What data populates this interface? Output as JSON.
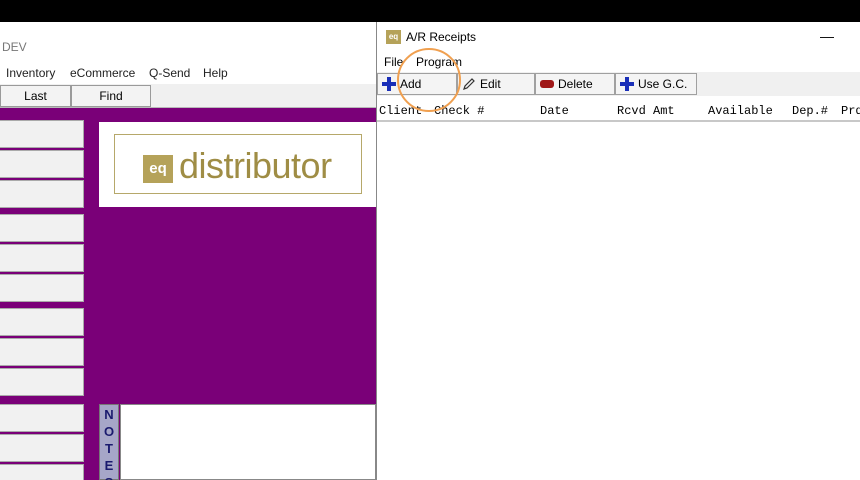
{
  "background_app": {
    "title": "DEV",
    "menu": [
      "Inventory",
      "eCommerce",
      "Q-Send",
      "Help"
    ],
    "toolbar": {
      "last_label": "Last",
      "find_label": "Find"
    },
    "logo": {
      "mark": "eq",
      "text": "distributor"
    },
    "notes_label": [
      "N",
      "O",
      "T",
      "E",
      "S"
    ]
  },
  "ar_window": {
    "title": "A/R Receipts",
    "icon_text": "eq",
    "minimize": "—",
    "menu": {
      "file": "File",
      "program": "Program"
    },
    "toolbar": {
      "add": "Add",
      "edit": "Edit",
      "delete": "Delete",
      "use_gc": "Use G.C."
    },
    "columns": [
      "Client",
      "Check #",
      "Date",
      "Rcvd Amt",
      "Available",
      "Dep.#",
      "Prd"
    ]
  },
  "colors": {
    "purple": "#7a0078",
    "logo_gold": "#9f8d45",
    "highlight": "#f0a050"
  }
}
